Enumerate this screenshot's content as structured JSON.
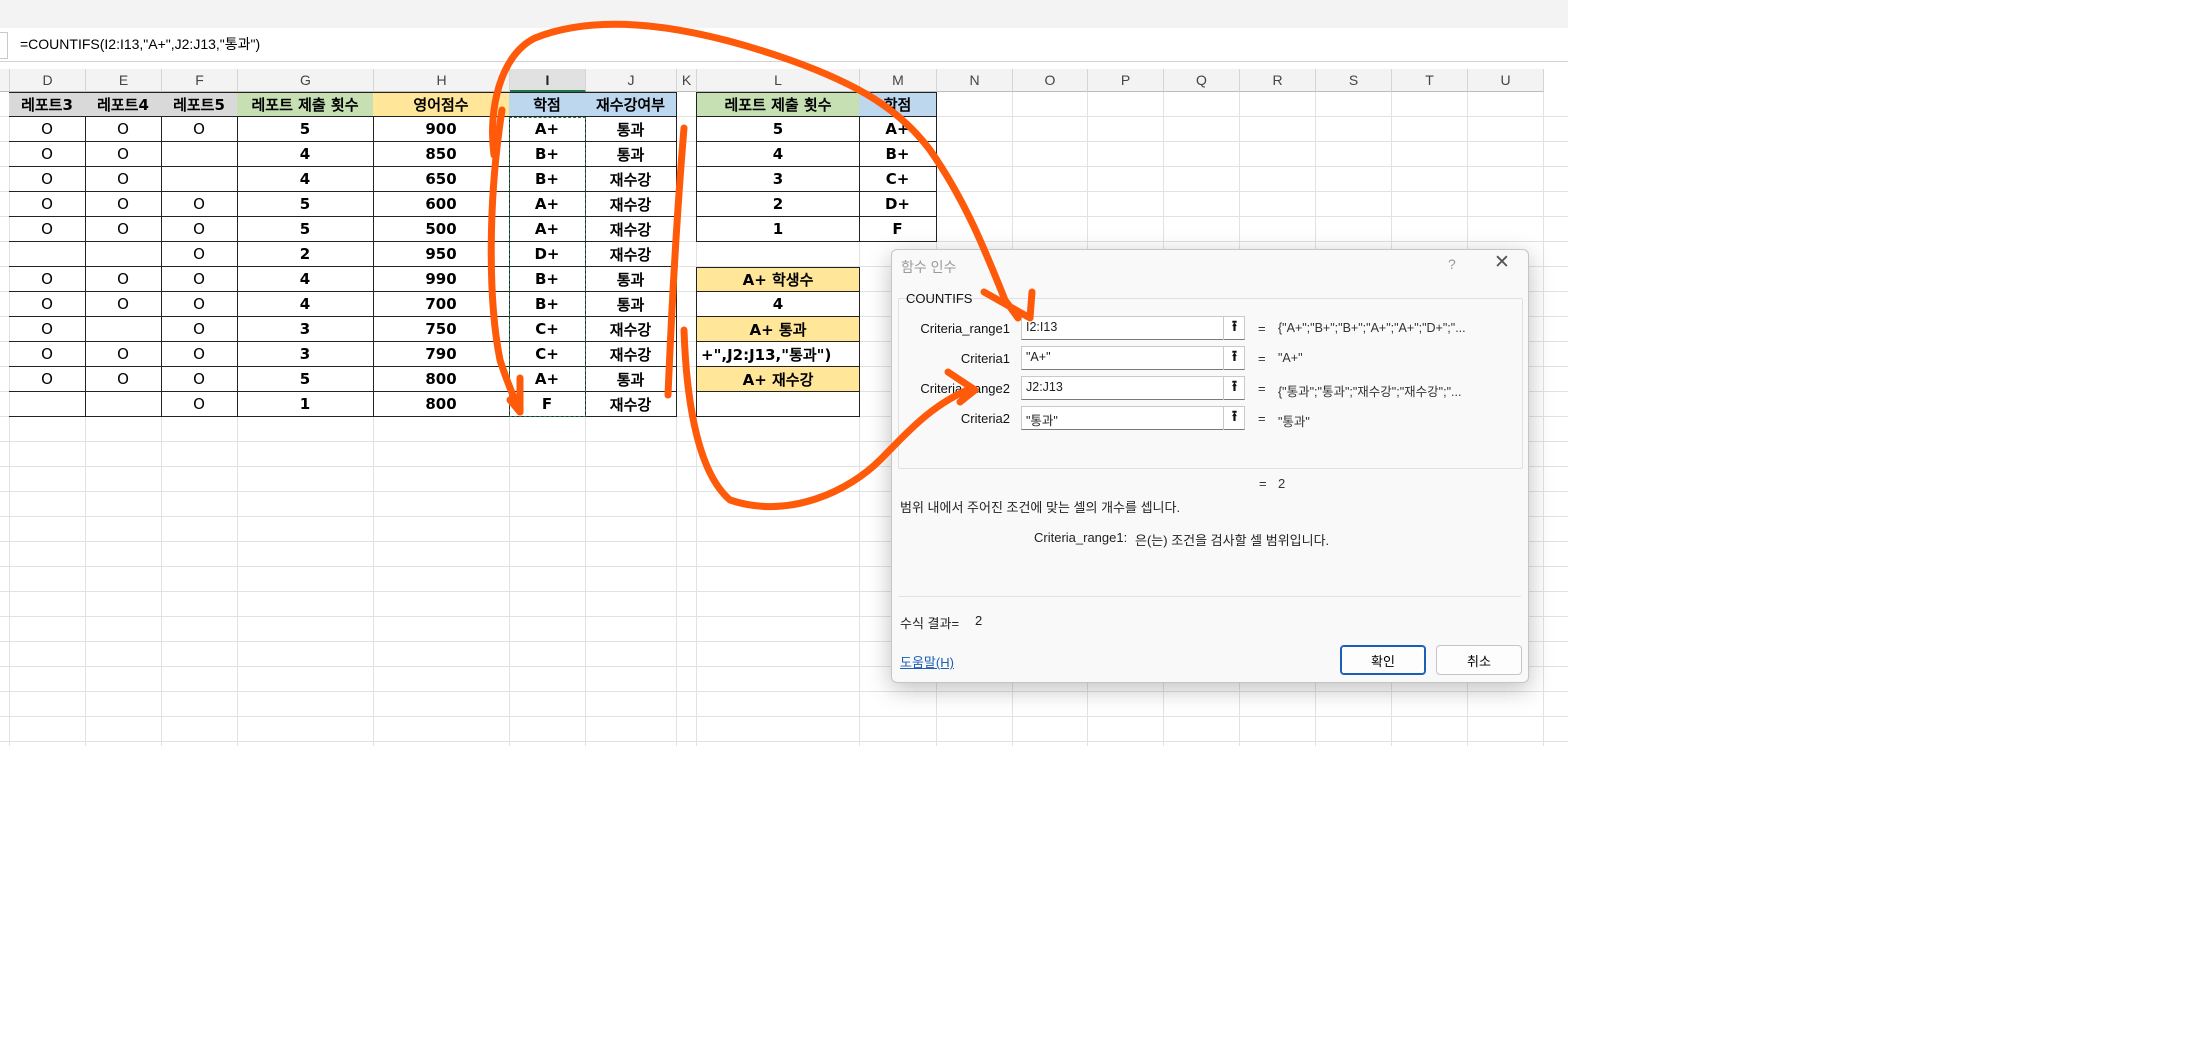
{
  "formula_bar": {
    "text": "=COUNTIFS(I2:I13,\"A+\",J2:J13,\"통과\")"
  },
  "columns": [
    "D",
    "E",
    "F",
    "G",
    "H",
    "I",
    "J",
    "K",
    "L",
    "M",
    "N",
    "O",
    "P",
    "Q",
    "R",
    "S",
    "T",
    "U"
  ],
  "selected_column": "I",
  "table": {
    "headers": [
      "레포트3",
      "레포트4",
      "레포트5",
      "레포트 제출 횟수",
      "영어점수",
      "학점",
      "재수강여부"
    ],
    "rows": [
      [
        "O",
        "O",
        "O",
        "5",
        "900",
        "A+",
        "통과"
      ],
      [
        "O",
        "O",
        "",
        "4",
        "850",
        "B+",
        "통과"
      ],
      [
        "O",
        "O",
        "",
        "4",
        "650",
        "B+",
        "재수강"
      ],
      [
        "O",
        "O",
        "O",
        "5",
        "600",
        "A+",
        "재수강"
      ],
      [
        "O",
        "O",
        "O",
        "5",
        "500",
        "A+",
        "재수강"
      ],
      [
        "",
        "",
        "O",
        "2",
        "950",
        "D+",
        "재수강"
      ],
      [
        "O",
        "O",
        "O",
        "4",
        "990",
        "B+",
        "통과"
      ],
      [
        "O",
        "O",
        "O",
        "4",
        "700",
        "B+",
        "통과"
      ],
      [
        "O",
        "",
        "O",
        "3",
        "750",
        "C+",
        "재수강"
      ],
      [
        "O",
        "O",
        "O",
        "3",
        "790",
        "C+",
        "재수강"
      ],
      [
        "O",
        "O",
        "O",
        "5",
        "800",
        "A+",
        "통과"
      ],
      [
        "",
        "",
        "O",
        "1",
        "800",
        "F",
        "재수강"
      ]
    ]
  },
  "lookup_table": {
    "headers": [
      "레포트 제출 횟수",
      "학점"
    ],
    "rows": [
      [
        "5",
        "A+"
      ],
      [
        "4",
        "B+"
      ],
      [
        "3",
        "C+"
      ],
      [
        "2",
        "D+"
      ],
      [
        "1",
        "F"
      ]
    ]
  },
  "summary": {
    "a_plus_count_label": "A+ 학생수",
    "a_plus_count_value": "4",
    "a_plus_pass_label": "A+ 통과",
    "a_plus_pass_editing": "+\",J2:J13,\"통과\")",
    "a_plus_retake_label": "A+ 재수강",
    "a_plus_retake_value": ""
  },
  "dialog": {
    "title": "함수 인수",
    "help_symbol": "?",
    "close_symbol": "✕",
    "function_name": "COUNTIFS",
    "args": [
      {
        "label": "Criteria_range1",
        "input": "I2:I13",
        "value": "{\"A+\";\"B+\";\"B+\";\"A+\";\"A+\";\"D+\";\"..."
      },
      {
        "label": "Criteria1",
        "input": "\"A+\"",
        "value": "\"A+\""
      },
      {
        "label": "Criteria_range2",
        "input": "J2:J13",
        "value": "{\"통과\";\"통과\";\"재수강\";\"재수강\";\"..."
      },
      {
        "label": "Criteria2",
        "input": "\"통과\"",
        "value": "\"통과\""
      }
    ],
    "equals": "=",
    "result_value": "2",
    "description": "범위 내에서 주어진 조건에 맞는 셀의 개수를 셉니다.",
    "arg_desc_name": "Criteria_range1:",
    "arg_desc_text": "은(는) 조건을 검사할 셀 범위입니다.",
    "formula_result_label": "수식 결과=",
    "formula_result_value": "2",
    "help_link": "도움말(H)",
    "ok_label": "확인",
    "cancel_label": "취소",
    "collapse_icon": "upload-arrow-icon"
  },
  "colors": {
    "annotation": "#ff5a0a",
    "selection": "#217346",
    "link": "#1a5fb4"
  }
}
